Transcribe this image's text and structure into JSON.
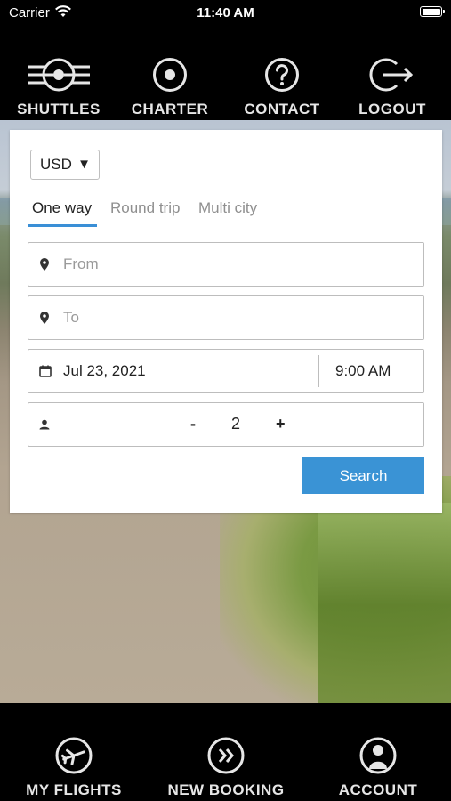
{
  "status_bar": {
    "carrier": "Carrier",
    "time": "11:40 AM"
  },
  "top_nav": [
    {
      "label": "SHUTTLES",
      "icon": "shuttles-icon"
    },
    {
      "label": "CHARTER",
      "icon": "charter-icon"
    },
    {
      "label": "CONTACT",
      "icon": "contact-icon"
    },
    {
      "label": "LOGOUT",
      "icon": "logout-icon"
    }
  ],
  "booking": {
    "currency": "USD",
    "tabs": [
      "One way",
      "Round trip",
      "Multi city"
    ],
    "active_tab": "One way",
    "from_placeholder": "From",
    "to_placeholder": "To",
    "date": "Jul 23, 2021",
    "time": "9:00 AM",
    "passengers": {
      "minus": "-",
      "value": "2",
      "plus": "+"
    },
    "search_label": "Search"
  },
  "bottom_nav": [
    {
      "label": "MY FLIGHTS",
      "icon": "airplane-icon"
    },
    {
      "label": "NEW BOOKING",
      "icon": "fast-forward-icon"
    },
    {
      "label": "ACCOUNT",
      "icon": "account-icon"
    }
  ],
  "colors": {
    "accent": "#3a93d5",
    "bar_bg": "#000000",
    "nav_text": "#e6e6e6"
  }
}
